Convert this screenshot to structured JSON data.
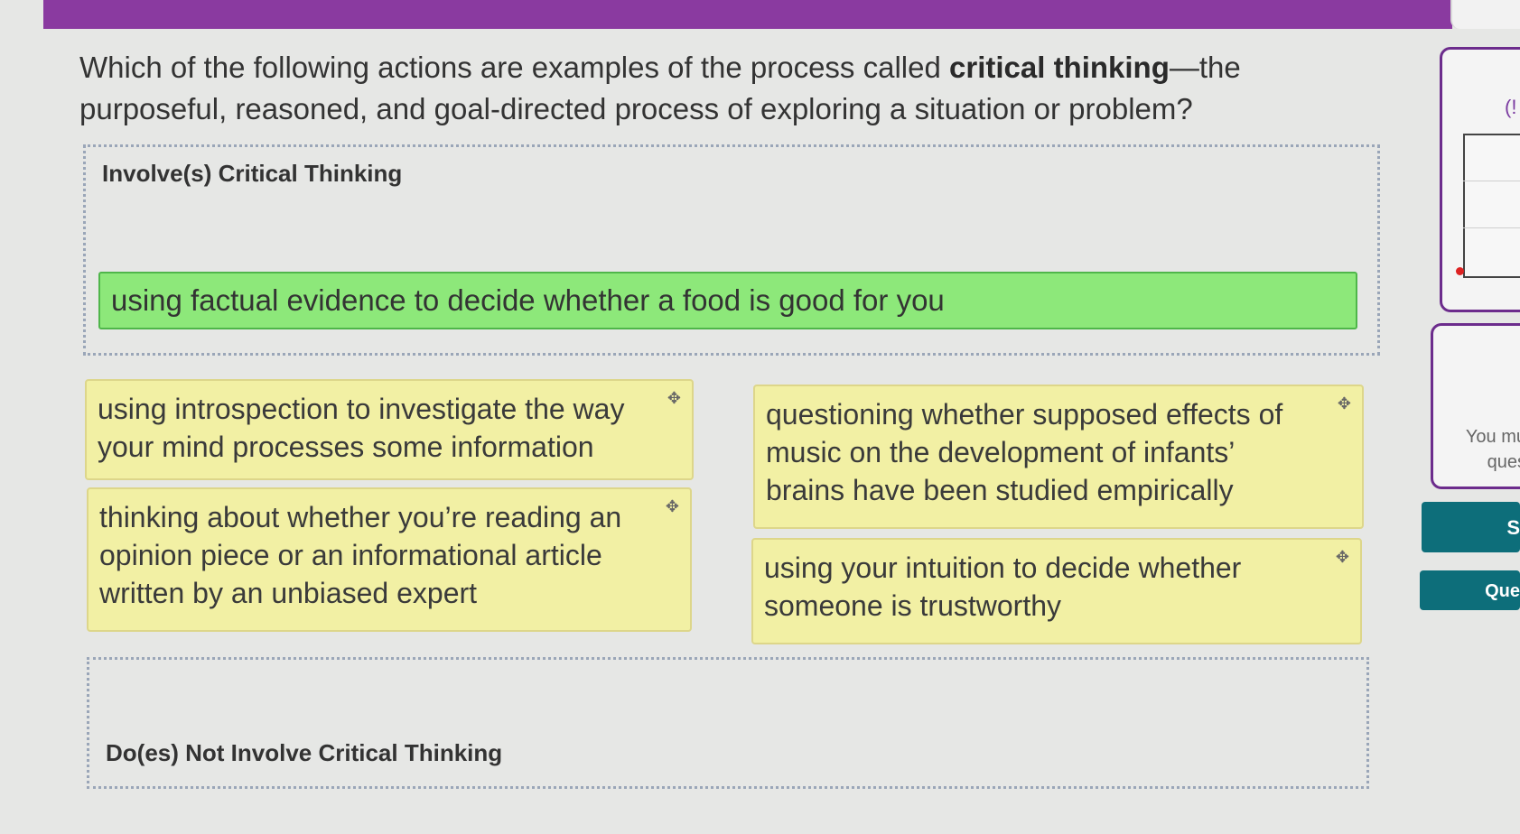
{
  "question": {
    "prefix": "Which of the following actions are examples of the process called ",
    "bold": "critical thinking",
    "suffix": "—the purposeful, reasoned, and goal-directed process of exploring a situation or problem?"
  },
  "zones": {
    "involves": {
      "title": "Involve(s) Critical Thinking",
      "placed_items": [
        "using factual evidence to decide whether a food is good for you"
      ]
    },
    "not_involves": {
      "title": "Do(es) Not Involve Critical Thinking"
    }
  },
  "cards": [
    "using introspection to investigate the way your mind processes some information",
    "thinking about whether you’re reading an opinion piece or an informational article written by an unbiased expert",
    "questioning whether supposed effects of music on the development of infants’ brains have been studied empirically",
    "using your intuition to decide whether someone is trustworthy"
  ],
  "sidebar": {
    "paren": "(!",
    "message_line1": "You mu",
    "message_line2": "ques",
    "button1": "S",
    "button2": "Que"
  },
  "icons": {
    "move": "move-icon"
  },
  "colors": {
    "header": "#8a3aa0",
    "placed_card": "#8de87a",
    "card": "#f2f0a4",
    "button": "#0d6e7a"
  }
}
